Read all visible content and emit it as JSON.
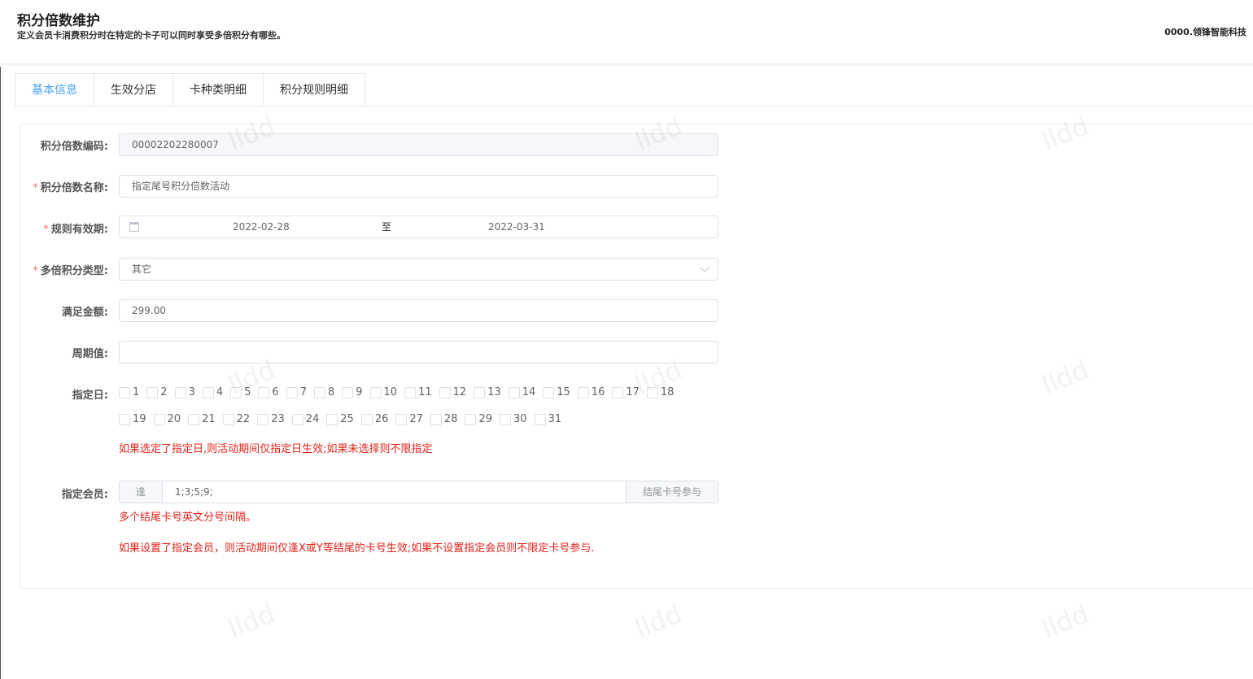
{
  "header": {
    "title": "积分倍数维护",
    "subtitle": "定义会员卡消费积分时在特定的卡子可以同时享受多倍积分有哪些。",
    "company": "0000.领锋智能科技"
  },
  "tabs": [
    {
      "label": "基本信息",
      "active": true
    },
    {
      "label": "生效分店",
      "active": false
    },
    {
      "label": "卡种类明细",
      "active": false
    },
    {
      "label": "积分规则明细",
      "active": false
    }
  ],
  "form": {
    "code": {
      "label": "积分倍数编码:",
      "value": "00002202280007",
      "required": false
    },
    "name": {
      "label": "积分倍数名称:",
      "value": "指定尾号积分倍数活动",
      "required": true
    },
    "validity": {
      "label": "规则有效期:",
      "start": "2022-02-28",
      "separator": "至",
      "end": "2022-03-31",
      "required": true
    },
    "type": {
      "label": "多倍积分类型:",
      "value": "其它",
      "required": true
    },
    "amount": {
      "label": "满足金额:",
      "value": "299.00"
    },
    "period": {
      "label": "周期值:",
      "value": ""
    },
    "days": {
      "label": "指定日:",
      "row1": [
        "1",
        "2",
        "3",
        "4",
        "5",
        "6",
        "7",
        "8",
        "9",
        "10",
        "11",
        "12",
        "13",
        "14",
        "15",
        "16",
        "17",
        "18"
      ],
      "row2": [
        "19",
        "20",
        "21",
        "22",
        "23",
        "24",
        "25",
        "26",
        "27",
        "28",
        "29",
        "30",
        "31"
      ],
      "checked": [],
      "hint": "如果选定了指定日,则活动期间仅指定日生效;如果未选择则不限指定"
    },
    "members": {
      "label": "指定会员:",
      "prepend": "逢",
      "value": "1;3;5;9;",
      "append": "结尾卡号参与",
      "hint1": "多个结尾卡号英文分号间隔。",
      "hint2": "如果设置了指定会员，则活动期间仅逢X或Y等结尾的卡号生效;如果不设置指定会员则不限定卡号参与."
    }
  },
  "watermark": "lldd",
  "colors": {
    "accent": "#409eff",
    "required": "#f56c6c",
    "hint": "#e2231a"
  }
}
